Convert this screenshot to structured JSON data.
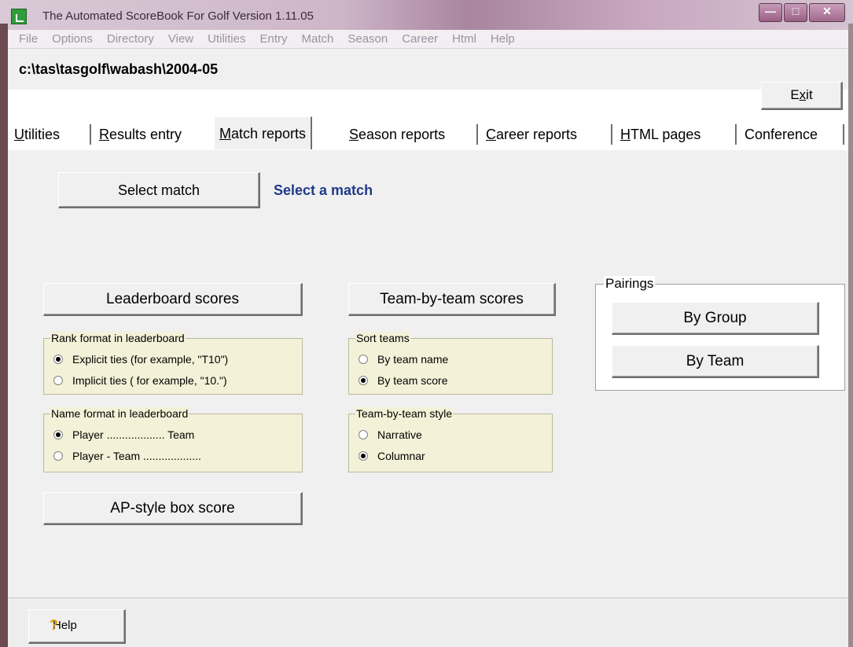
{
  "window": {
    "title": "The Automated ScoreBook For Golf  Version 1.11.05",
    "minimize_glyph": "—",
    "maximize_glyph": "□",
    "close_glyph": "✕"
  },
  "menubar": {
    "items": [
      "File",
      "Options",
      "Directory",
      "View",
      "Utilities",
      "Entry",
      "Match",
      "Season",
      "Career",
      "Html",
      "Help"
    ]
  },
  "pathbar": {
    "path": "c:\\tas\\tasgolf\\wabash\\2004-05",
    "exit_label_prefix": "E",
    "exit_label_underlined": "x",
    "exit_label_suffix": "it"
  },
  "tabs": [
    {
      "u": "U",
      "rest": "tilities"
    },
    {
      "u": "R",
      "rest": "esults entry"
    },
    {
      "u": "M",
      "rest": "atch reports"
    },
    {
      "u": "S",
      "rest": "eason reports"
    },
    {
      "u": "C",
      "rest": "areer reports"
    },
    {
      "u": "H",
      "rest": "TML pages"
    },
    {
      "u": "",
      "rest": "Conference"
    }
  ],
  "match": {
    "select_button": "Select match",
    "select_status": "Select a match"
  },
  "leaderboard": {
    "button": "Leaderboard scores",
    "rank_group_title": "Rank format in leaderboard",
    "rank_options": [
      "Explicit ties (for example, \"T10\")",
      "Implicit ties ( for example, \"10.\")"
    ],
    "rank_selected": 0,
    "name_group_title": "Name format in leaderboard",
    "name_options": [
      "Player ................... Team",
      "Player - Team ..................."
    ],
    "name_selected": 0
  },
  "team": {
    "button": "Team-by-team scores",
    "sort_group_title": "Sort teams",
    "sort_options": [
      "By team name",
      "By team score"
    ],
    "sort_selected": 1,
    "style_group_title": "Team-by-team style",
    "style_options": [
      "Narrative",
      "Columnar"
    ],
    "style_selected": 1
  },
  "ap": {
    "button": "AP-style box score"
  },
  "pairings": {
    "title": "Pairings",
    "by_group": "By Group",
    "by_team": "By Team"
  },
  "status": {
    "help_label": "Help",
    "help_icon_glyph": "?"
  },
  "colors": {
    "accent_label": "#1f3a8a",
    "group_bg": "#f3f2d8"
  }
}
